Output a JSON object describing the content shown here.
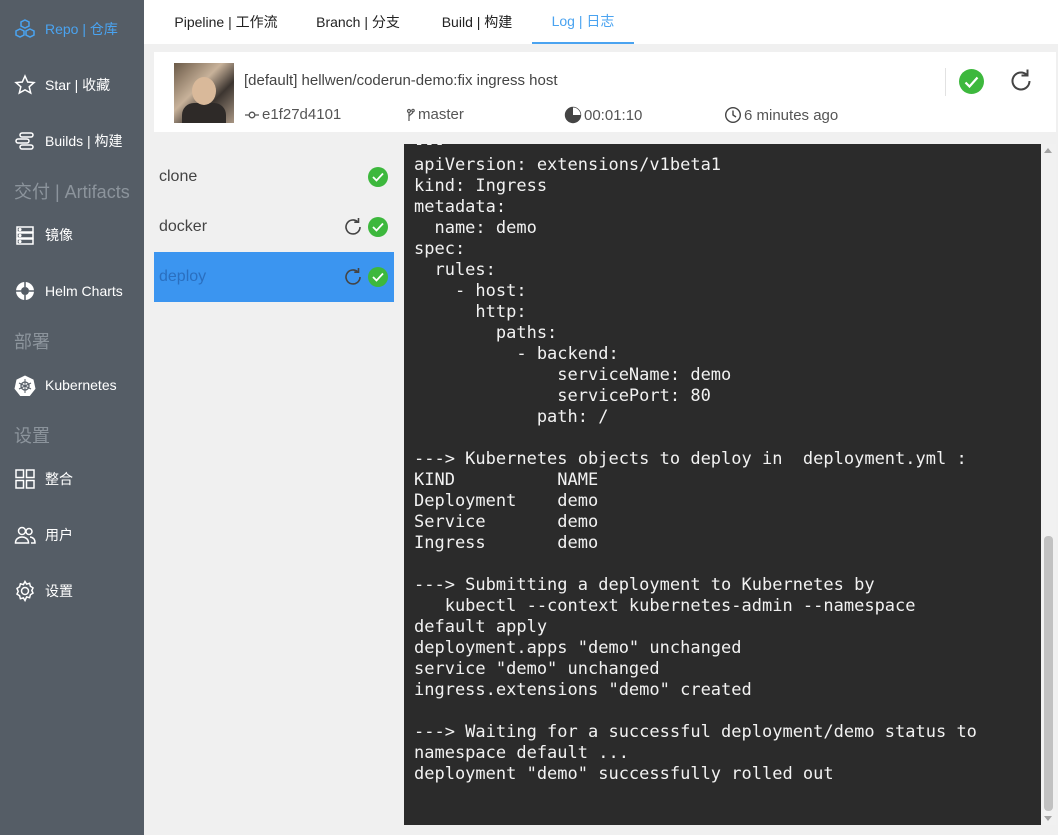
{
  "sidebar": {
    "items": [
      {
        "label": "Repo | 仓库",
        "icon": "cubes-icon",
        "active": true
      },
      {
        "label": "Star | 收藏",
        "icon": "star-icon"
      },
      {
        "label": "Builds | 构建",
        "icon": "builds-icon"
      },
      {
        "label": "镜像",
        "icon": "server-icon"
      },
      {
        "label": "Helm Charts",
        "icon": "helm-icon"
      },
      {
        "label": "Kubernetes",
        "icon": "kubernetes-icon"
      },
      {
        "label": "整合",
        "icon": "grid-icon"
      },
      {
        "label": "用户",
        "icon": "users-icon"
      },
      {
        "label": "设置",
        "icon": "gear-icon"
      }
    ],
    "groups": {
      "artifacts": "交付 | Artifacts",
      "deploy": "部署",
      "settings": "设置"
    },
    "accent_color": "#4aa3f0",
    "background": "#555d66"
  },
  "tabs": [
    {
      "label": "Pipeline | 工作流"
    },
    {
      "label": "Branch | 分支"
    },
    {
      "label": "Build | 构建"
    },
    {
      "label": "Log | 日志",
      "active": true
    }
  ],
  "build": {
    "title": "[default] hellwen/coderun-demo:fix ingress host",
    "commit": "e1f27d4101",
    "branch": "master",
    "duration": "00:01:10",
    "time_ago": "6 minutes ago",
    "status": "success",
    "status_color": "#3db83d"
  },
  "steps": [
    {
      "name": "clone",
      "status": "success"
    },
    {
      "name": "docker",
      "status": "success",
      "restartable": true
    },
    {
      "name": "deploy",
      "status": "success",
      "restartable": true,
      "active": true
    }
  ],
  "log": {
    "lines": [
      "---",
      "apiVersion: extensions/v1beta1",
      "kind: Ingress",
      "metadata:",
      "  name: demo",
      "spec:",
      "  rules:",
      "    - host:",
      "      http:",
      "        paths:",
      "          - backend:",
      "              serviceName: demo",
      "              servicePort: 80",
      "            path: /",
      "",
      "---> Kubernetes objects to deploy in  deployment.yml :",
      "KIND          NAME",
      "Deployment    demo",
      "Service       demo",
      "Ingress       demo",
      "",
      "---> Submitting a deployment to Kubernetes by",
      "   kubectl --context kubernetes-admin --namespace",
      "default apply",
      "deployment.apps \"demo\" unchanged",
      "service \"demo\" unchanged",
      "ingress.extensions \"demo\" created",
      "",
      "---> Waiting for a successful deployment/demo status to",
      "namespace default ...",
      "deployment \"demo\" successfully rolled out"
    ]
  }
}
